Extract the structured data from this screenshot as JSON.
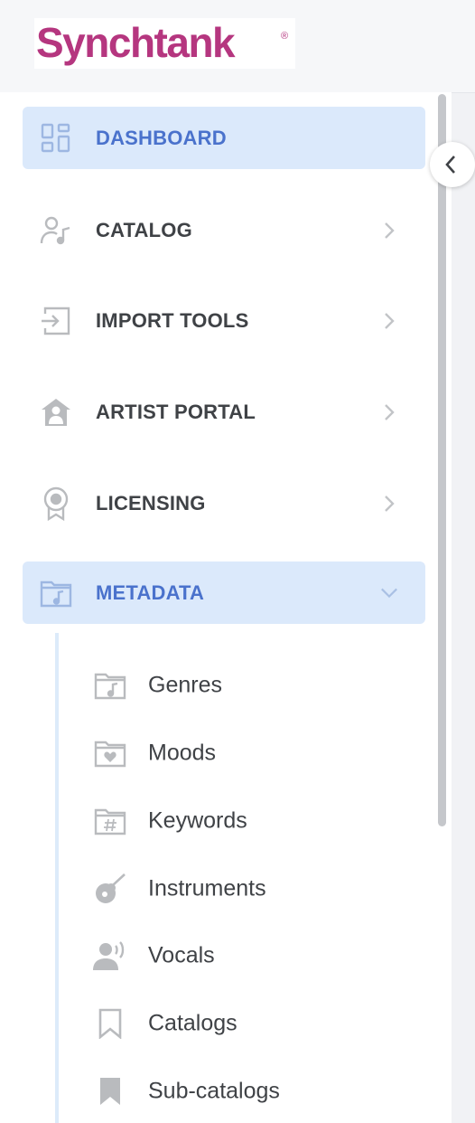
{
  "brand": {
    "name": "Synchtank",
    "reg": "®",
    "color": "#b5367f"
  },
  "colors": {
    "active_bg": "#dbe9fb",
    "active_text": "#4a72cc",
    "text": "#3f4246",
    "icon": "#b9bbbe"
  },
  "nav": {
    "dashboard": "DASHBOARD",
    "catalog": "CATALOG",
    "import_tools": "IMPORT TOOLS",
    "artist_portal": "ARTIST PORTAL",
    "licensing": "LICENSING",
    "metadata": "METADATA"
  },
  "metadata_sub": {
    "genres": "Genres",
    "moods": "Moods",
    "keywords": "Keywords",
    "instruments": "Instruments",
    "vocals": "Vocals",
    "catalogs": "Catalogs",
    "sub_catalogs": "Sub-catalogs"
  },
  "icons": {
    "dashboard": "dashboard-grid-icon",
    "catalog": "person-music-icon",
    "import_tools": "import-icon",
    "artist_portal": "house-person-icon",
    "licensing": "award-ribbon-icon",
    "metadata": "music-folder-icon",
    "genres": "music-folder-icon",
    "moods": "heart-folder-icon",
    "keywords": "hash-folder-icon",
    "instruments": "guitar-icon",
    "vocals": "speaking-person-icon",
    "catalogs": "bookmark-outline-icon",
    "sub_catalogs": "bookmark-filled-icon",
    "collapse": "chevron-left-icon"
  }
}
